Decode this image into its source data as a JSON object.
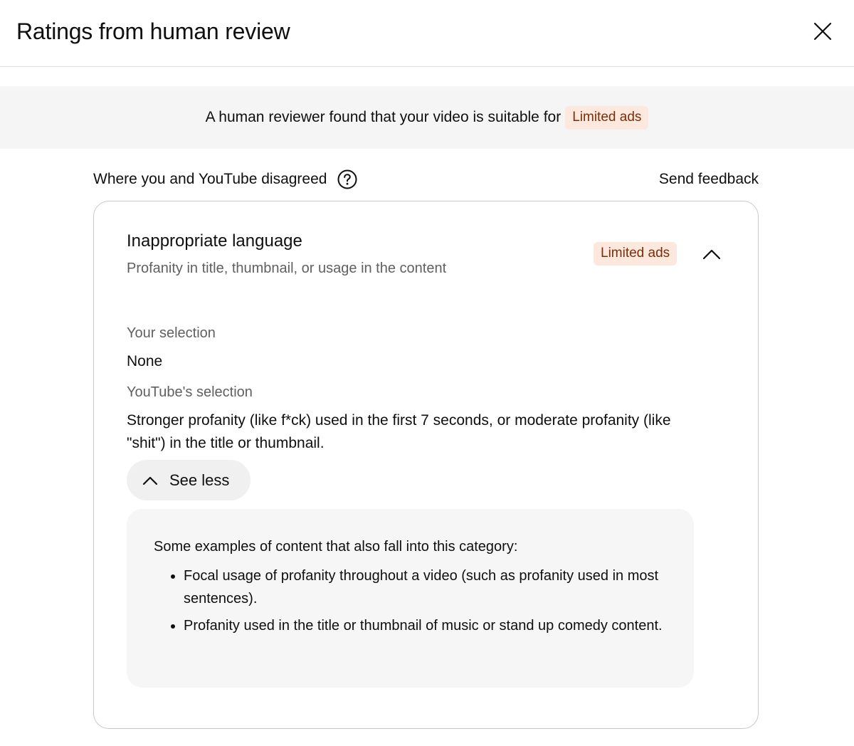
{
  "dialog": {
    "title": "Ratings from human review"
  },
  "banner": {
    "text": "A human reviewer found that your video is suitable for",
    "badge": "Limited ads"
  },
  "section": {
    "label": "Where you and YouTube disagreed",
    "feedback": "Send feedback"
  },
  "card": {
    "title": "Inappropriate language",
    "subtitle": "Profanity in title, thumbnail, or usage in the content",
    "badge": "Limited ads",
    "your_selection_label": "Your selection",
    "your_selection_value": "None",
    "youtube_selection_label": "YouTube's selection",
    "youtube_selection_value": "Stronger profanity (like f*ck) used in the first 7 seconds, or moderate profanity (like \"shit\") in the title or thumbnail.",
    "see_less": "See less",
    "examples": {
      "heading": "Some examples of content that also fall into this category",
      "heading_suffix": ":",
      "items": [
        "Focal usage of profanity throughout a video (such as profanity used in most sentences).",
        "Profanity used in the title or thumbnail of music or stand up comedy content."
      ]
    }
  },
  "colors": {
    "badge_bg": "#fde8dd",
    "badge_text": "#7a2e0a",
    "banner_bg": "#f5f5f5",
    "secondary_text": "#606060"
  },
  "icons": [
    "close-icon",
    "help-circle-icon",
    "chevron-up-icon"
  ]
}
